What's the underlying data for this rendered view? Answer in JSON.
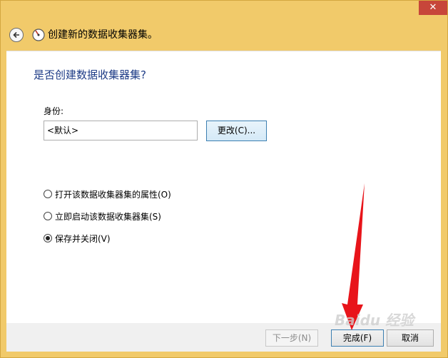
{
  "window": {
    "title": "创建新的数据收集器集。",
    "close_glyph": "✕"
  },
  "page": {
    "heading": "是否创建数据收集器集?"
  },
  "identity": {
    "label": "身份:",
    "value": "<默认>",
    "change_button": "更改(C)..."
  },
  "options": [
    {
      "label": "打开该数据收集器集的属性(O)",
      "checked": false
    },
    {
      "label": "立即启动该数据收集器集(S)",
      "checked": false
    },
    {
      "label": "保存并关闭(V)",
      "checked": true
    }
  ],
  "footer": {
    "next": "下一步(N)",
    "finish": "完成(F)",
    "cancel": "取消"
  },
  "watermark": "Baidu 经验",
  "colors": {
    "titlebar": "#f1ca6a",
    "heading": "#1e3c87",
    "arrow": "#e8141a",
    "close": "#c7463a"
  },
  "icons": {
    "back": "back-arrow-icon",
    "app": "performance-gauge-icon",
    "close": "close-icon"
  }
}
